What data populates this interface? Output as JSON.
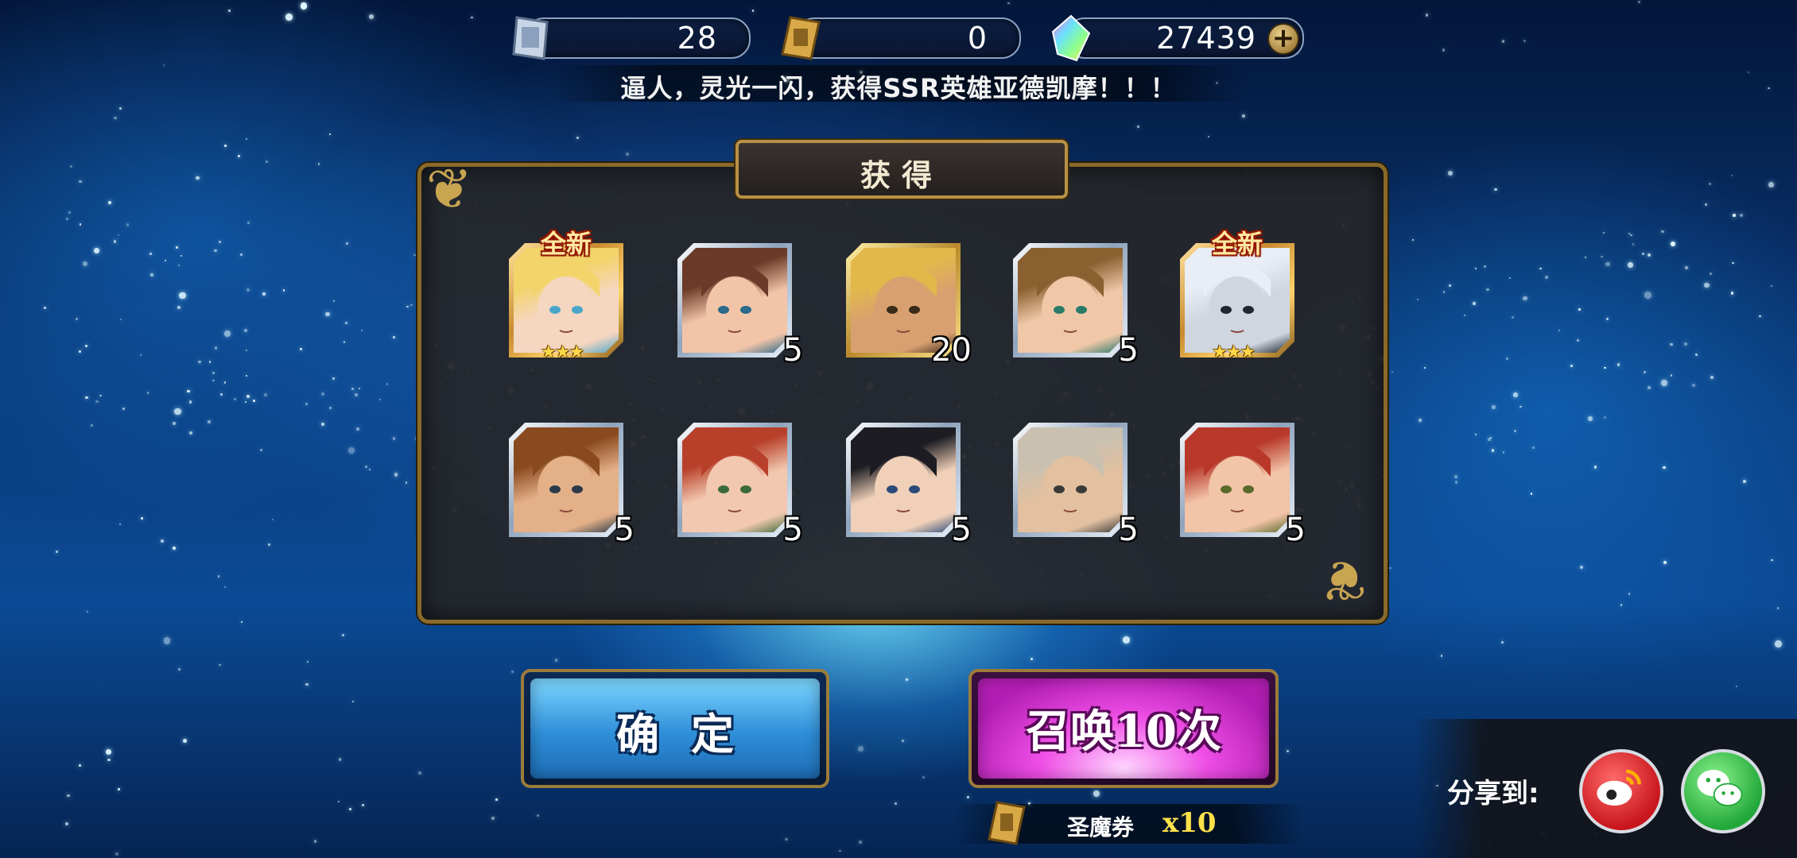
{
  "currencies": [
    {
      "name": "summon-ticket",
      "value": "28"
    },
    {
      "name": "holy-demon-ticket",
      "value": "0"
    },
    {
      "name": "rainbow-crystal",
      "value": "27439"
    }
  ],
  "notice": "逼人，灵光一闪，获得SSR英雄亚德凯摩！！！",
  "panel_title": "获得",
  "results": [
    {
      "new_label": "全新",
      "stars": "★★★",
      "count": "",
      "rarity": "ssr"
    },
    {
      "new_label": "",
      "stars": "",
      "count": "5",
      "rarity": "normal"
    },
    {
      "new_label": "",
      "stars": "",
      "count": "20",
      "rarity": "gold"
    },
    {
      "new_label": "",
      "stars": "",
      "count": "5",
      "rarity": "normal"
    },
    {
      "new_label": "全新",
      "stars": "★★★",
      "count": "",
      "rarity": "ssr"
    },
    {
      "new_label": "",
      "stars": "",
      "count": "5",
      "rarity": "normal"
    },
    {
      "new_label": "",
      "stars": "",
      "count": "5",
      "rarity": "normal"
    },
    {
      "new_label": "",
      "stars": "",
      "count": "5",
      "rarity": "normal"
    },
    {
      "new_label": "",
      "stars": "",
      "count": "5",
      "rarity": "normal"
    },
    {
      "new_label": "",
      "stars": "",
      "count": "5",
      "rarity": "normal"
    }
  ],
  "buttons": {
    "confirm": "确定",
    "summon": "召唤10次"
  },
  "cost": {
    "item": "圣魔券",
    "multiplier": "x10"
  },
  "share": {
    "label": "分享到:",
    "weibo_icon": "weibo-icon",
    "wechat_icon": "wechat-icon"
  }
}
